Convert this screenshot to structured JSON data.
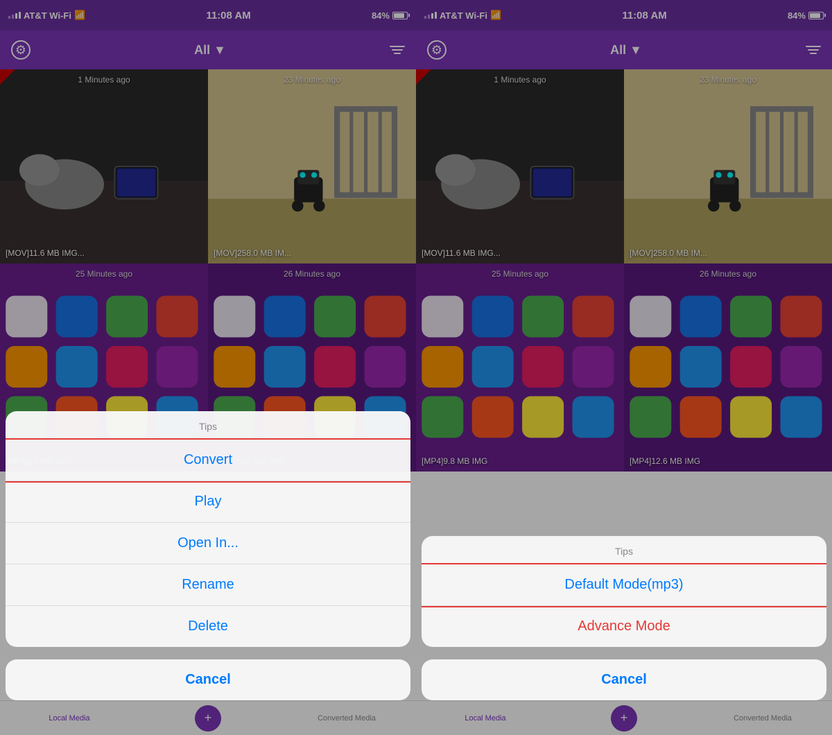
{
  "left_panel": {
    "status_bar": {
      "carrier": "AT&T Wi-Fi",
      "time": "11:08 AM",
      "battery": "84%"
    },
    "toolbar": {
      "filter_label": "All",
      "dropdown_arrow": "▼"
    },
    "videos": [
      {
        "timestamp": "1 Minutes ago",
        "file_label": "[MOV]11.6 MB IMG...",
        "has_badge": true
      },
      {
        "timestamp": "23 Minutes ago",
        "file_label": "[MOV]258.0 MB IM...",
        "has_badge": false
      },
      {
        "timestamp": "25 Minutes ago",
        "file_label": "[MP4]9.8 MB IMG",
        "has_badge": false
      },
      {
        "timestamp": "26 Minutes ago",
        "file_label": "[MP4]12.6 MB IMG",
        "has_badge": false
      }
    ],
    "modal": {
      "title": "Tips",
      "items": [
        {
          "label": "Convert",
          "highlighted": true
        },
        {
          "label": "Play",
          "highlighted": false
        },
        {
          "label": "Open In...",
          "highlighted": false
        },
        {
          "label": "Rename",
          "highlighted": false
        },
        {
          "label": "Delete",
          "highlighted": false
        }
      ],
      "cancel_label": "Cancel"
    },
    "bottom_nav": [
      {
        "label": "Local Media",
        "active": true
      },
      {
        "label": "",
        "is_center": true
      },
      {
        "label": "Converted Media",
        "active": false
      }
    ]
  },
  "right_panel": {
    "status_bar": {
      "carrier": "AT&T Wi-Fi",
      "time": "11:08 AM",
      "battery": "84%"
    },
    "toolbar": {
      "filter_label": "All",
      "dropdown_arrow": "▼"
    },
    "videos": [
      {
        "timestamp": "1 Minutes ago",
        "file_label": "[MOV]11.6 MB IMG...",
        "has_badge": true
      },
      {
        "timestamp": "23 Minutes ago",
        "file_label": "[MOV]258.0 MB IM...",
        "has_badge": false
      },
      {
        "timestamp": "25 Minutes ago",
        "file_label": "[MP4]9.8 MB IMG",
        "has_badge": false
      },
      {
        "timestamp": "26 Minutes ago",
        "file_label": "[MP4]12.6 MB IMG",
        "has_badge": false
      }
    ],
    "modal": {
      "title": "Tips",
      "items": [
        {
          "label": "Default Mode(mp3)",
          "highlighted": true,
          "color": "blue"
        },
        {
          "label": "Advance Mode",
          "highlighted": false,
          "color": "red"
        }
      ],
      "cancel_label": "Cancel"
    },
    "bottom_nav": [
      {
        "label": "Local Media",
        "active": true
      },
      {
        "label": "",
        "is_center": true
      },
      {
        "label": "Converted Media",
        "active": false
      }
    ]
  }
}
